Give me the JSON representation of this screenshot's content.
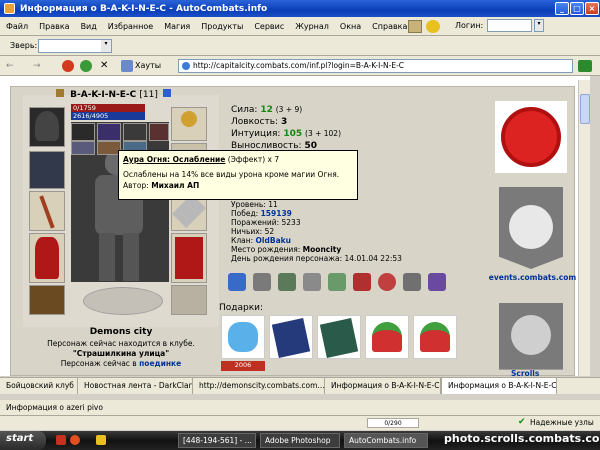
{
  "window": {
    "title": "Информация о B-A-K-I-N-E-C - AutoCombats.info"
  },
  "menu": [
    "Файл",
    "Правка",
    "Вид",
    "Избранное",
    "Магия",
    "Продукты",
    "Сервис",
    "Журнал",
    "Окна",
    "Справка"
  ],
  "login": {
    "label": "Логин:",
    "value": ""
  },
  "beast": {
    "label": "Зверь:",
    "value": ""
  },
  "nav": {
    "hosts_label": "Хауты",
    "url": "http://capitalcity.combats.com/inf.pl?login=B-A-K-I-N-E-C"
  },
  "profile": {
    "name": "B-A-K-I-N-E-C",
    "level_badge": "[11]",
    "hp": "0/1759",
    "mana": "2616/4905",
    "stats": {
      "strength_label": "Сила:",
      "strength": "12",
      "strength_extra": "(3 + 9)",
      "agility_label": "Ловкость:",
      "agility": "3",
      "intuition_label": "Интуиция:",
      "intuition": "105",
      "intuition_extra": "(3 + 102)",
      "endurance_label": "Выносливость:",
      "endurance": "50"
    },
    "info": {
      "level": "Уровень: 11",
      "wins_label": "Побед:",
      "wins": "159139",
      "losses": "Поражений: 5233",
      "draws": "Ничьих: 52",
      "clan_label": "Клан:",
      "clan": "OldBaku",
      "birthplace_label": "Место рождения:",
      "birthplace": "Mooncity",
      "birthday": "День рождения персонажа: 14.01.04 22:53"
    },
    "city": "Demons city",
    "location_text": "Персонаж сейчас находится в клубе.",
    "location_place": "\"Страшилкина улица\"",
    "fight_text": "Персонаж сейчас в",
    "fight_link": "поединке",
    "gifts_label": "Подарки:",
    "gift_badge": "2006"
  },
  "tooltip": {
    "title": "Аура Огня: Ослабление",
    "title_suffix": "(Эффект) x 7",
    "desc": "Ослаблены на 14% все виды урона кроме магии Огня.",
    "author_label": "Автор:",
    "author": "Михаил АП"
  },
  "right_col": {
    "events": "events.combats.com",
    "scrolls": "Scrolls"
  },
  "tabs": [
    "Бойцовский клуб",
    "Новостная лента - DarkClan",
    "http://demonscity.combats.com...",
    "Информация о B-A-K-I-N-E-C",
    "Информация о B-A-K-I-N-E-C"
  ],
  "status": {
    "text": "Информация о azeri pivo",
    "progress": "0/290",
    "zone": "Надежные узлы"
  },
  "taskbar": {
    "start": "start",
    "tasks": [
      "[448-194-561] - ...",
      "Adobe Photoshop",
      "AutoCombats.info"
    ],
    "watermark": "photo.scrolls.combats.com"
  },
  "colors": {
    "green": "#118811",
    "link": "#003399",
    "emblem_red": "#dd2222"
  }
}
